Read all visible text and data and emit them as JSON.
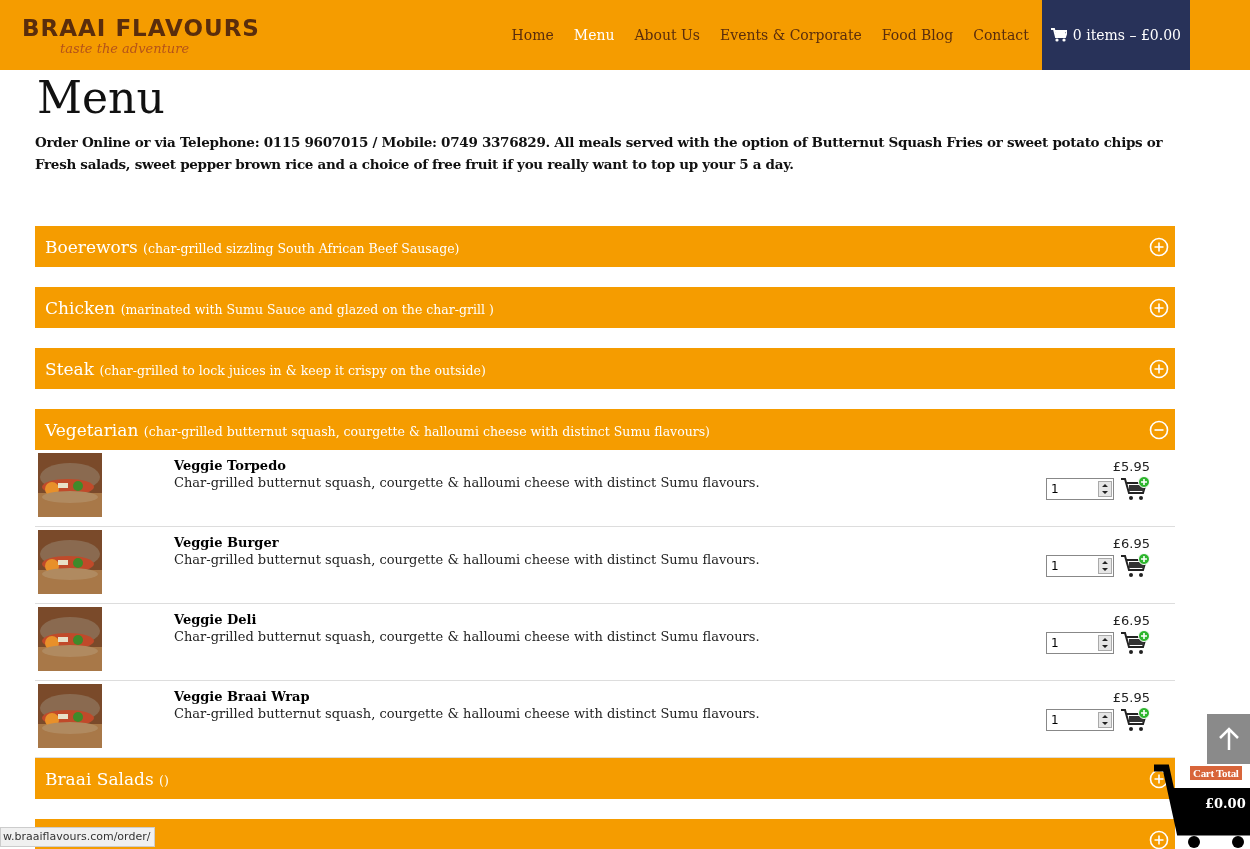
{
  "header": {
    "logo": {
      "name": "BRAAI FLAVOURS",
      "tagline": "taste the adventure"
    },
    "nav": [
      {
        "label": "Home",
        "selected": false
      },
      {
        "label": "Menu",
        "selected": true
      },
      {
        "label": "About Us",
        "selected": false
      },
      {
        "label": "Events & Corporate",
        "selected": false
      },
      {
        "label": "Food Blog",
        "selected": false
      },
      {
        "label": "Contact",
        "selected": false
      }
    ],
    "cart": "0 items – £0.00"
  },
  "page": {
    "title": "Menu",
    "intro": " Order Online or via Telephone: 0115 9607015 / Mobile: 0749 3376829. All meals served with the option of Butternut Squash Fries or sweet potato chips or Fresh salads, sweet pepper brown rice and a choice of free fruit if you really want to top up your 5 a day."
  },
  "sections": [
    {
      "name": "Boerewors",
      "note": "(char-grilled sizzling South African Beef Sausage)",
      "expanded": false
    },
    {
      "name": "Chicken",
      "note": "(marinated with Sumu Sauce and glazed on the char-grill )",
      "expanded": false
    },
    {
      "name": "Steak",
      "note": "(char-grilled to lock juices in & keep it crispy on the outside)",
      "expanded": false
    },
    {
      "name": "Vegetarian",
      "note": "(char-grilled butternut squash, courgette & halloumi cheese with distinct Sumu flavours)",
      "expanded": true,
      "items": [
        {
          "name": "Veggie Torpedo",
          "description": "Char-grilled butternut squash, courgette & halloumi cheese with distinct Sumu flavours.",
          "price": "£5.95",
          "quantity": "1"
        },
        {
          "name": "Veggie Burger",
          "description": "Char-grilled butternut squash, courgette & halloumi cheese with distinct Sumu flavours.",
          "price": "£6.95",
          "quantity": "1"
        },
        {
          "name": "Veggie Deli",
          "description": "Char-grilled butternut squash, courgette & halloumi cheese with distinct Sumu flavours.",
          "price": "£6.95",
          "quantity": "1"
        },
        {
          "name": "Veggie Braai Wrap",
          "description": "Char-grilled butternut squash, courgette & halloumi cheese with distinct Sumu flavours.",
          "price": "£5.95",
          "quantity": "1"
        }
      ]
    },
    {
      "name": "Braai Salads",
      "note": "()",
      "expanded": false
    },
    {
      "expanded": false
    }
  ],
  "cart_widget": {
    "label": "Cart Total",
    "total": "£0.00"
  },
  "status_url": "w.braaiflavours.com/order/"
}
